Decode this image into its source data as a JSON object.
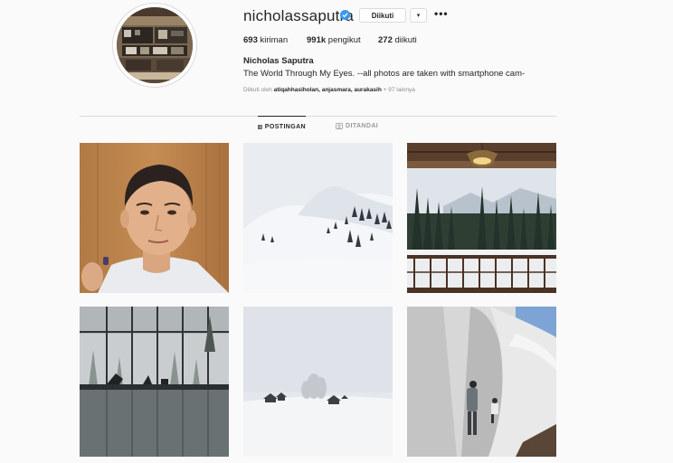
{
  "profile": {
    "username": "nicholassaputra",
    "follow_label": "Diikuti",
    "dropdown_icon": "▾",
    "more_icon": "•••",
    "stats": {
      "posts_value": "693",
      "posts_label": "kiriman",
      "followers_value": "991k",
      "followers_label": "pengikut",
      "following_value": "272",
      "following_label": "diikuti"
    },
    "full_name": "Nicholas Saputra",
    "bio": "The World Through My Eyes. --all photos are taken with smartphone cam-",
    "followed_by_prefix": "Diikuti oleh",
    "followed_by_names": "atiqahhasiholan, anjasmara, aurakasih",
    "followed_by_more": "+ 97 lainnya"
  },
  "tabs": [
    {
      "label": "POSTINGAN",
      "icon": "grid-icon",
      "active": true
    },
    {
      "label": "DITANDAI",
      "icon": "tag-icon",
      "active": false
    }
  ],
  "posts": [
    {
      "subject": "selfie-portrait"
    },
    {
      "subject": "snowy-mountain-slope"
    },
    {
      "subject": "snowy-forest-view-from-balcony"
    },
    {
      "subject": "foggy-window-reflection"
    },
    {
      "subject": "snow-field-houses"
    },
    {
      "subject": "white-architecture-climbers"
    }
  ],
  "colors": {
    "background": "#fafafa",
    "text": "#262626",
    "muted": "#8e8e8e",
    "border": "#dbdbdb",
    "verified": "#3897f0"
  }
}
